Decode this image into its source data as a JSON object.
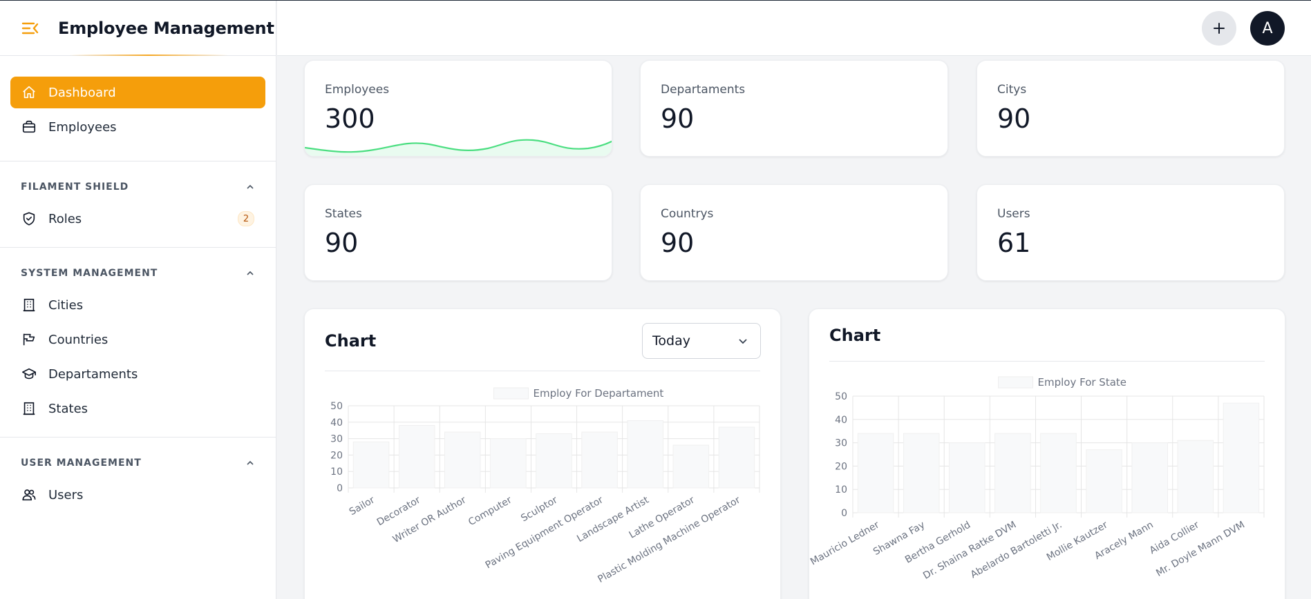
{
  "app": {
    "title": "Employee Management"
  },
  "header": {
    "avatar_initial": "A"
  },
  "sidebar": {
    "main_items": [
      {
        "label": "Dashboard",
        "icon": "home-icon",
        "active": true
      },
      {
        "label": "Employees",
        "icon": "briefcase-icon"
      }
    ],
    "sections": [
      {
        "label": "FILAMENT SHIELD",
        "items": [
          {
            "label": "Roles",
            "icon": "shield-check-icon",
            "badge": "2"
          }
        ]
      },
      {
        "label": "SYSTEM MANAGEMENT",
        "items": [
          {
            "label": "Cities",
            "icon": "building-icon"
          },
          {
            "label": "Countries",
            "icon": "flag-icon"
          },
          {
            "label": "Departaments",
            "icon": "academic-cap-icon"
          },
          {
            "label": "States",
            "icon": "building-icon"
          }
        ]
      },
      {
        "label": "USER MANAGEMENT",
        "items": [
          {
            "label": "Users",
            "icon": "users-icon"
          }
        ]
      }
    ]
  },
  "stats": [
    {
      "label": "Employees",
      "value": "300"
    },
    {
      "label": "Departaments",
      "value": "90"
    },
    {
      "label": "Citys",
      "value": "90"
    },
    {
      "label": "States",
      "value": "90"
    },
    {
      "label": "Countrys",
      "value": "90"
    },
    {
      "label": "Users",
      "value": "61"
    }
  ],
  "chart_cards": [
    {
      "title": "Chart",
      "filter": "Today"
    },
    {
      "title": "Chart"
    }
  ],
  "colors": {
    "accent": "#f59e0b",
    "spark": "#4ade80",
    "bar": "#f8f9fa"
  },
  "chart_data": [
    {
      "type": "bar",
      "legend": "Employ For Departament",
      "categories": [
        "Sailor",
        "Decorator",
        "Writer OR Author",
        "Computer",
        "Sculptor",
        "Paving Equipment Operator",
        "Landscape Artist",
        "Lathe Operator",
        "Plastic Molding Machine Operator"
      ],
      "values": [
        28,
        38,
        34,
        30,
        33,
        34,
        41,
        26,
        37
      ],
      "ylim": [
        0,
        50
      ],
      "yticks": [
        0,
        10,
        20,
        30,
        40,
        50
      ],
      "grid": true
    },
    {
      "type": "bar",
      "legend": "Employ For State",
      "categories": [
        "Mauricio Ledner",
        "Shawna Fay",
        "Bertha Gerhold",
        "Dr. Shaina Ratke DVM",
        "Abelardo Bartoletti Jr.",
        "Mollie Kautzer",
        "Aracely Mann",
        "Aida Collier",
        "Mr. Doyle Mann DVM"
      ],
      "values": [
        34,
        34,
        30,
        34,
        34,
        27,
        30,
        31,
        47
      ],
      "ylim": [
        0,
        50
      ],
      "yticks": [
        0,
        10,
        20,
        30,
        40,
        50
      ],
      "grid": true
    }
  ]
}
